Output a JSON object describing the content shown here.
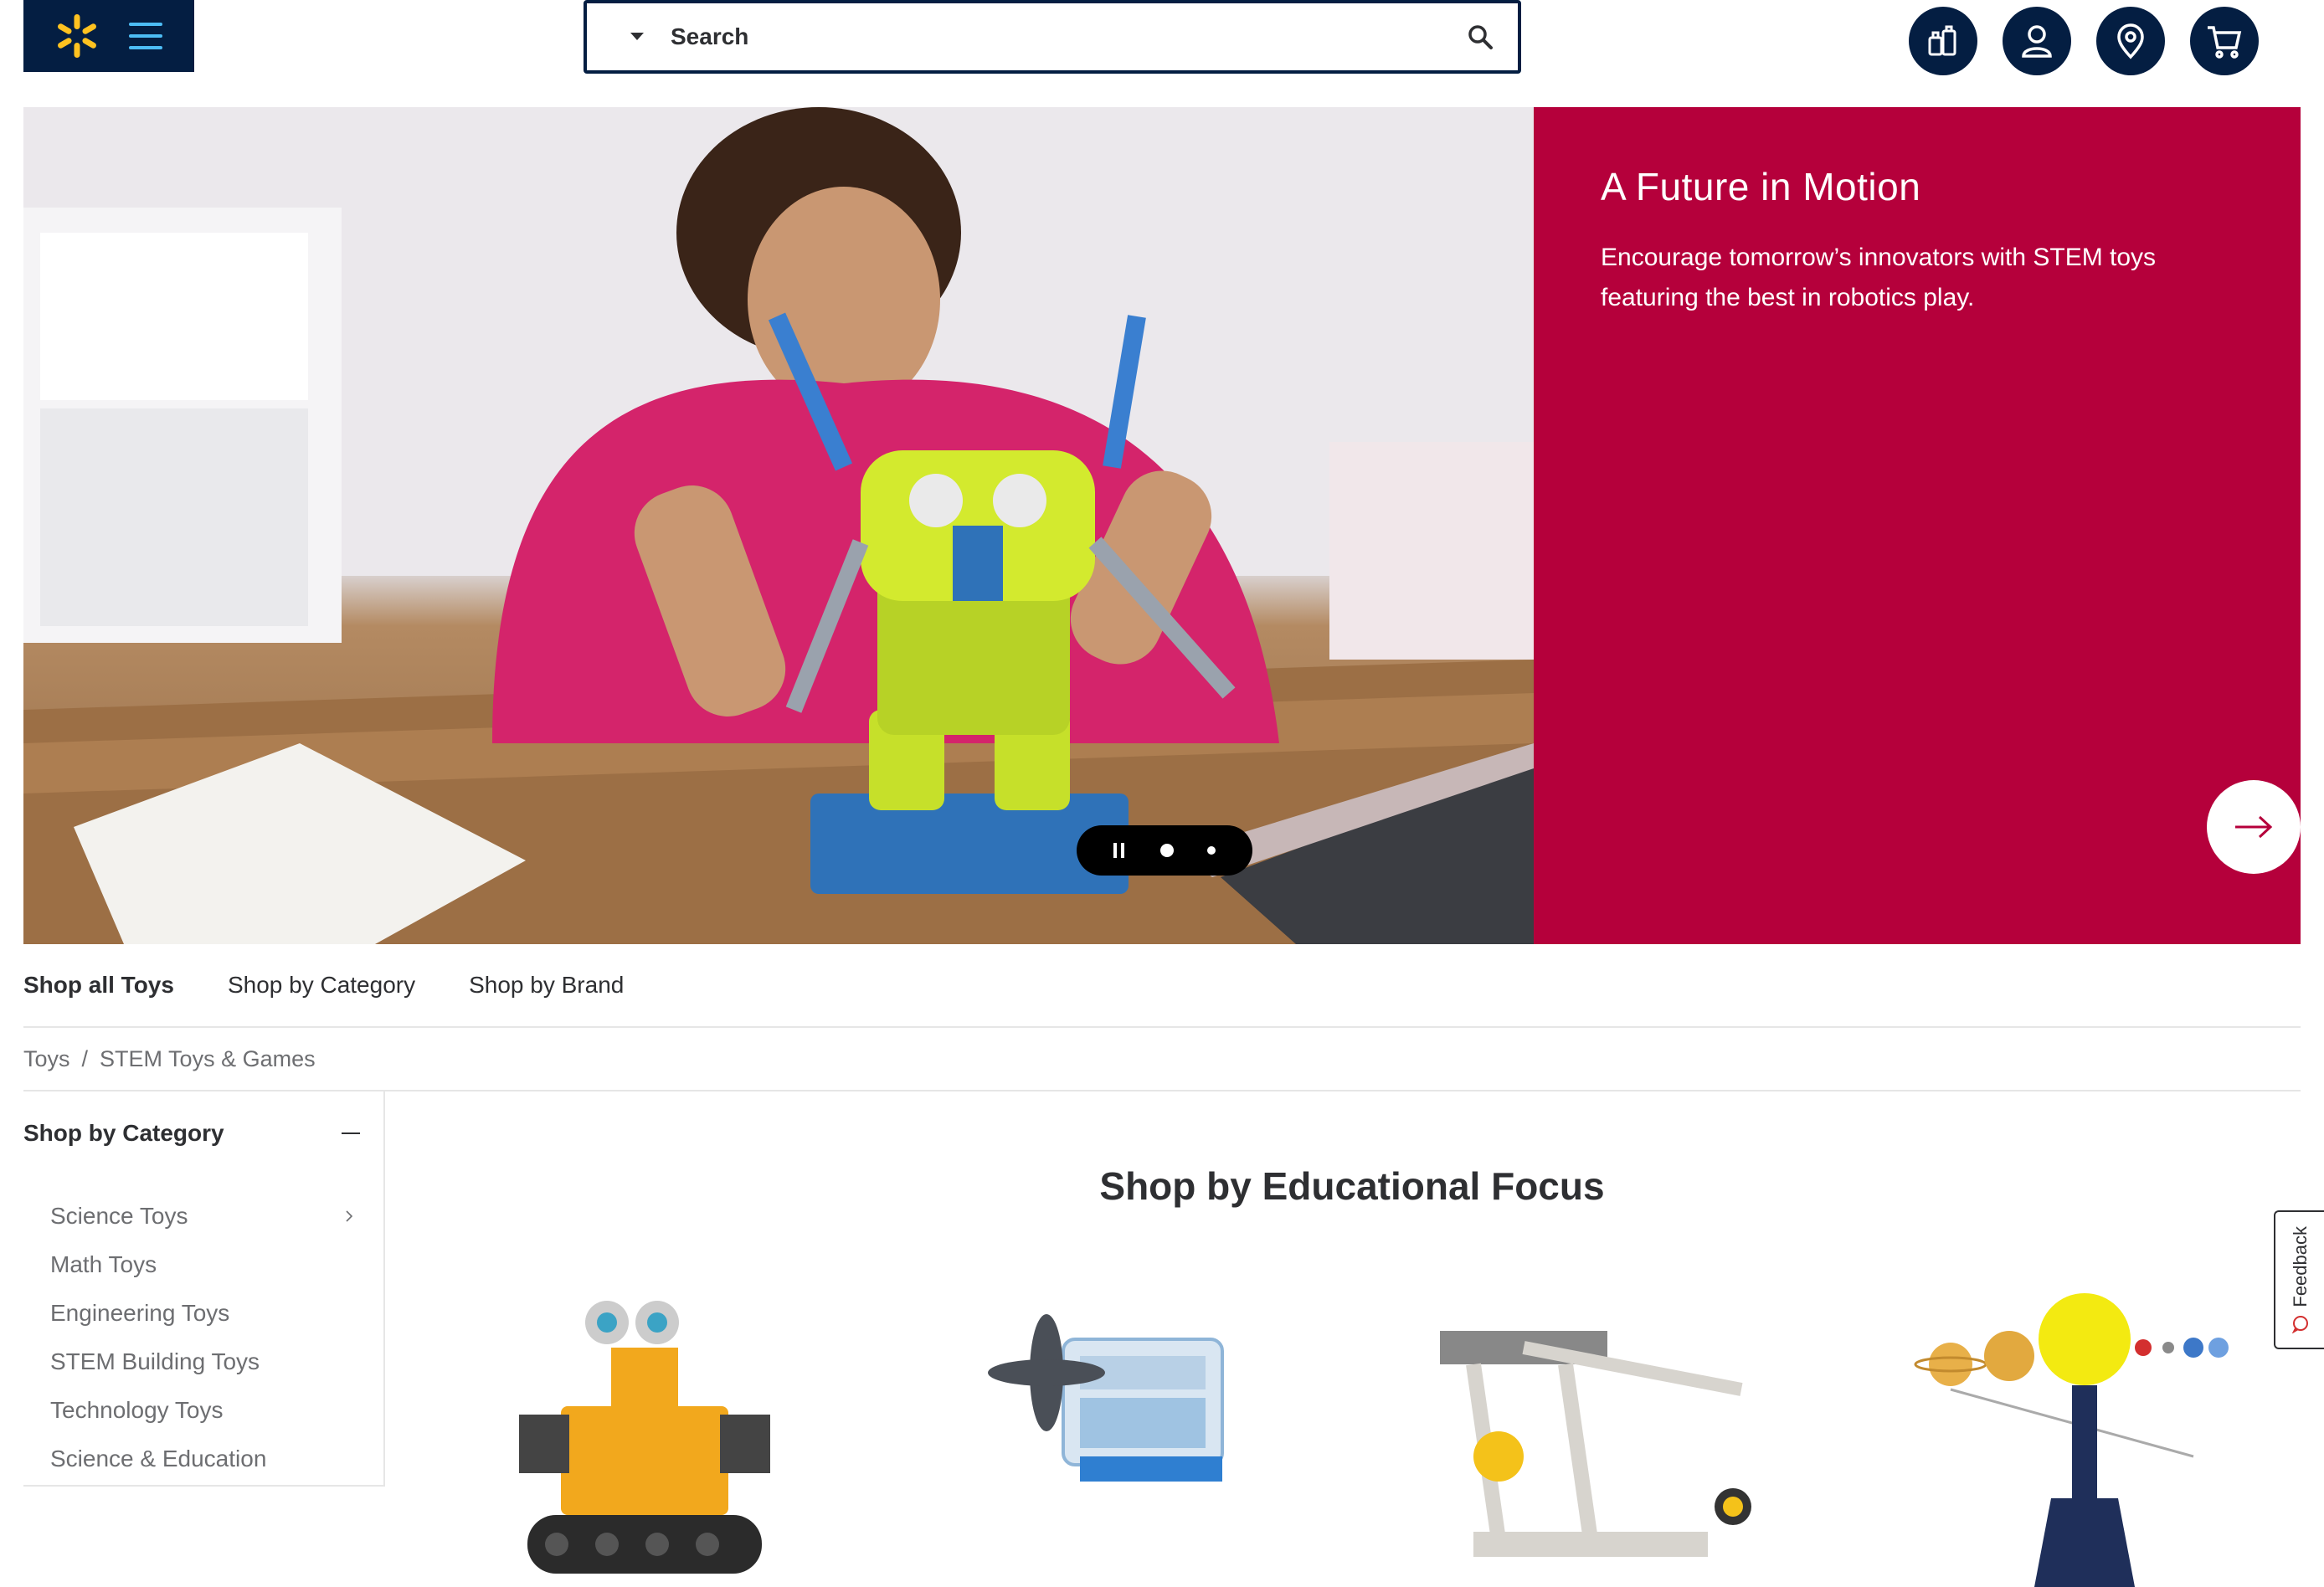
{
  "header": {
    "search_placeholder": "Search",
    "icons": [
      "spark-logo-icon",
      "menu-icon",
      "departments-icon",
      "account-icon",
      "store-location-icon",
      "cart-icon"
    ],
    "brand_color": "#041e42",
    "spark_color": "#ffc220",
    "menu_color": "#4dbdf5"
  },
  "hero": {
    "title": "A Future in Motion",
    "description": "Encourage tomorrow’s innovators with STEM toys featuring the best in robotics play.",
    "panel_color": "#b5003b",
    "slide_count": 2,
    "active_slide": 1
  },
  "subnav": {
    "items": [
      {
        "label": "Shop all Toys",
        "bold": true
      },
      {
        "label": "Shop by Category",
        "bold": false
      },
      {
        "label": "Shop by Brand",
        "bold": false
      }
    ]
  },
  "breadcrumb": {
    "items": [
      "Toys",
      "STEM Toys & Games"
    ],
    "separator": "/"
  },
  "sidebar": {
    "title": "Shop by Category",
    "items": [
      "Science Toys",
      "Math Toys",
      "Engineering Toys",
      "STEM Building Toys",
      "Technology Toys",
      "Science & Education"
    ]
  },
  "main": {
    "section_title": "Shop by Educational Focus"
  },
  "feedback": {
    "label": "Feedback"
  }
}
